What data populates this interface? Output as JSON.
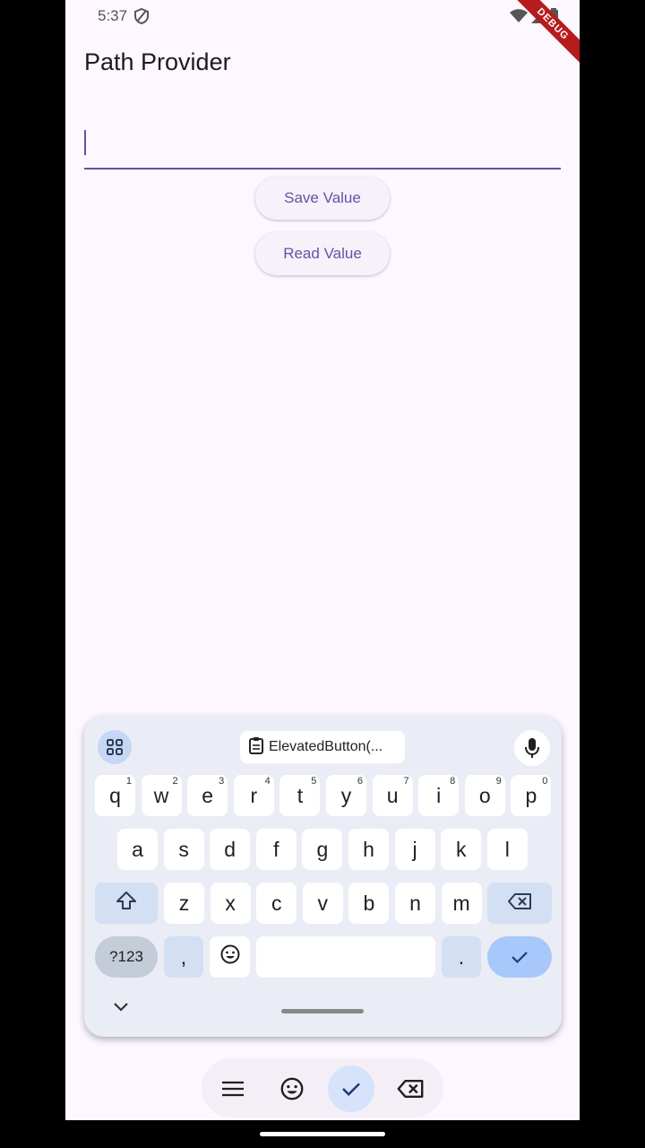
{
  "status": {
    "time": "5:37",
    "debug_label": "DEBUG"
  },
  "app": {
    "title": "Path Provider"
  },
  "input": {
    "value": "",
    "placeholder": ""
  },
  "buttons": {
    "save_label": "Save Value",
    "read_label": "Read Value"
  },
  "keyboard": {
    "clipboard_text": "ElevatedButton(...",
    "row1": [
      {
        "k": "q",
        "h": "1"
      },
      {
        "k": "w",
        "h": "2"
      },
      {
        "k": "e",
        "h": "3"
      },
      {
        "k": "r",
        "h": "4"
      },
      {
        "k": "t",
        "h": "5"
      },
      {
        "k": "y",
        "h": "6"
      },
      {
        "k": "u",
        "h": "7"
      },
      {
        "k": "i",
        "h": "8"
      },
      {
        "k": "o",
        "h": "9"
      },
      {
        "k": "p",
        "h": "0"
      }
    ],
    "row2": [
      "a",
      "s",
      "d",
      "f",
      "g",
      "h",
      "j",
      "k",
      "l"
    ],
    "row3": [
      "z",
      "x",
      "c",
      "v",
      "b",
      "n",
      "m"
    ],
    "symbols_label": "?123",
    "comma": ",",
    "period": "."
  },
  "icons": {
    "apps": "apps-grid-icon",
    "clipboard": "clipboard-icon",
    "mic": "mic-icon",
    "shift": "shift-icon",
    "backspace": "backspace-icon",
    "emoji": "emoji-icon",
    "done": "check-icon",
    "hide": "chevron-down-icon",
    "menu": "menu-icon"
  },
  "colors": {
    "accent": "#6750a4",
    "background": "#fdf7ff",
    "keyboard_bg": "#eaedf5",
    "done_key": "#a8c7fa"
  }
}
